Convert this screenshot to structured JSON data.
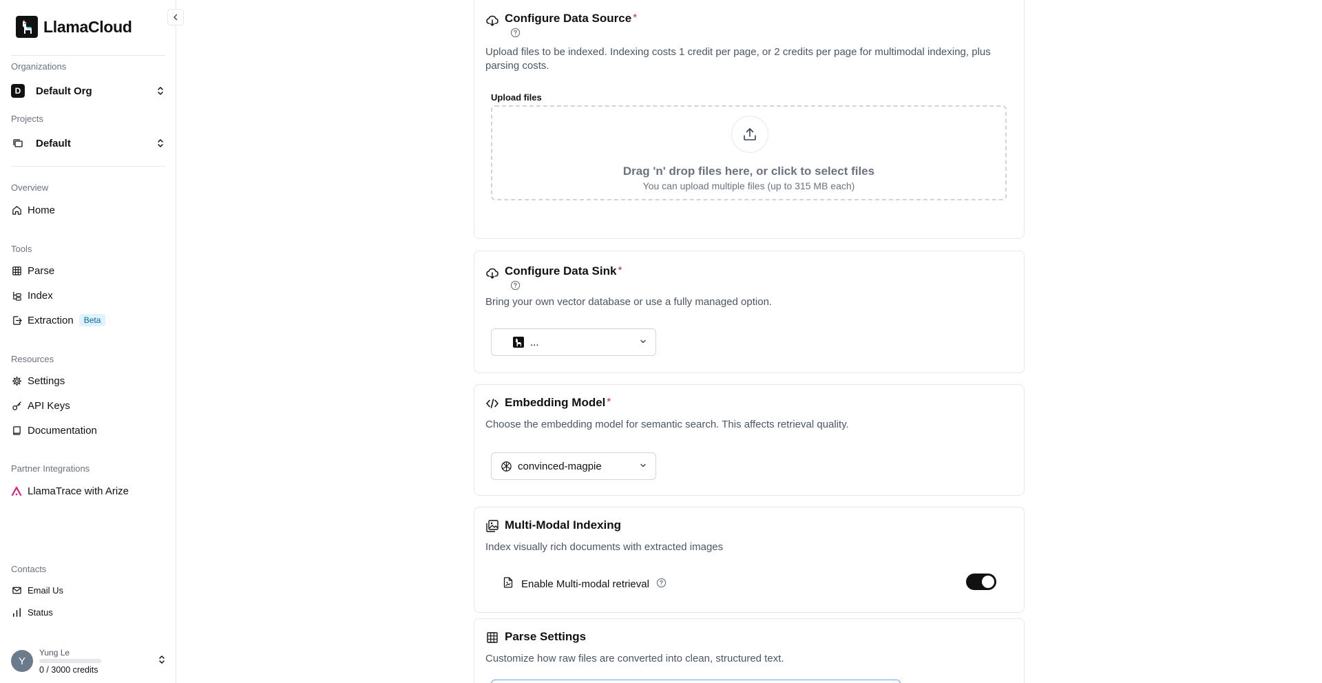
{
  "app": {
    "name": "LlamaCloud"
  },
  "sidebar": {
    "organizations_label": "Organizations",
    "org": {
      "badge": "D",
      "name": "Default Org"
    },
    "projects_label": "Projects",
    "project": {
      "name": "Default"
    },
    "overview_label": "Overview",
    "overview_items": [
      {
        "label": "Home",
        "icon": "home-icon"
      }
    ],
    "tools_label": "Tools",
    "tools_items": [
      {
        "label": "Parse",
        "icon": "grid-icon"
      },
      {
        "label": "Index",
        "icon": "tree-icon"
      },
      {
        "label": "Extraction",
        "icon": "extract-icon",
        "badge": "Beta"
      }
    ],
    "resources_label": "Resources",
    "resources_items": [
      {
        "label": "Settings",
        "icon": "gear-icon"
      },
      {
        "label": "API Keys",
        "icon": "key-icon"
      },
      {
        "label": "Documentation",
        "icon": "book-icon"
      }
    ],
    "partner_label": "Partner Integrations",
    "partner_items": [
      {
        "label": "LlamaTrace with Arize",
        "icon": "arize-icon"
      }
    ],
    "contacts_label": "Contacts",
    "contacts_items": [
      {
        "label": "Email Us",
        "icon": "mail-icon"
      },
      {
        "label": "Status",
        "icon": "bar-chart-icon"
      }
    ],
    "user": {
      "avatar_letter": "Y",
      "name": "Yung Le",
      "credits": "0 / 3000 credits",
      "credits_used_fraction": 0
    }
  },
  "main": {
    "data_source": {
      "title": "Configure Data Source",
      "required_mark": "*",
      "description": "Upload files to be indexed. Indexing costs 1 credit per page, or 2 credits per page for multimodal indexing, plus parsing costs.",
      "upload_label": "Upload files",
      "dropzone_main": "Drag 'n' drop files here, or click to select files",
      "dropzone_sub": "You can upload multiple files (up to 315 MB each)"
    },
    "data_sink": {
      "title": "Configure Data Sink",
      "required_mark": "*",
      "description": "Bring your own vector database or use a fully managed option.",
      "selected": "..."
    },
    "embedding": {
      "title": "Embedding Model",
      "required_mark": "*",
      "description": "Choose the embedding model for semantic search. This affects retrieval quality.",
      "selected": "convinced-magpie"
    },
    "multimodal": {
      "title": "Multi-Modal Indexing",
      "description": "Index visually rich documents with extracted images",
      "toggle_label": "Enable Multi-modal retrieval",
      "enabled": true
    },
    "parse_settings": {
      "title": "Parse Settings",
      "description": "Customize how raw files are converted into clean, structured text."
    }
  },
  "colors": {
    "required": "#dc2626",
    "toggle_on": "#111111",
    "arize_accent": "#e11d74",
    "beta_bg": "#e0f2fe",
    "beta_text": "#0369a1"
  }
}
